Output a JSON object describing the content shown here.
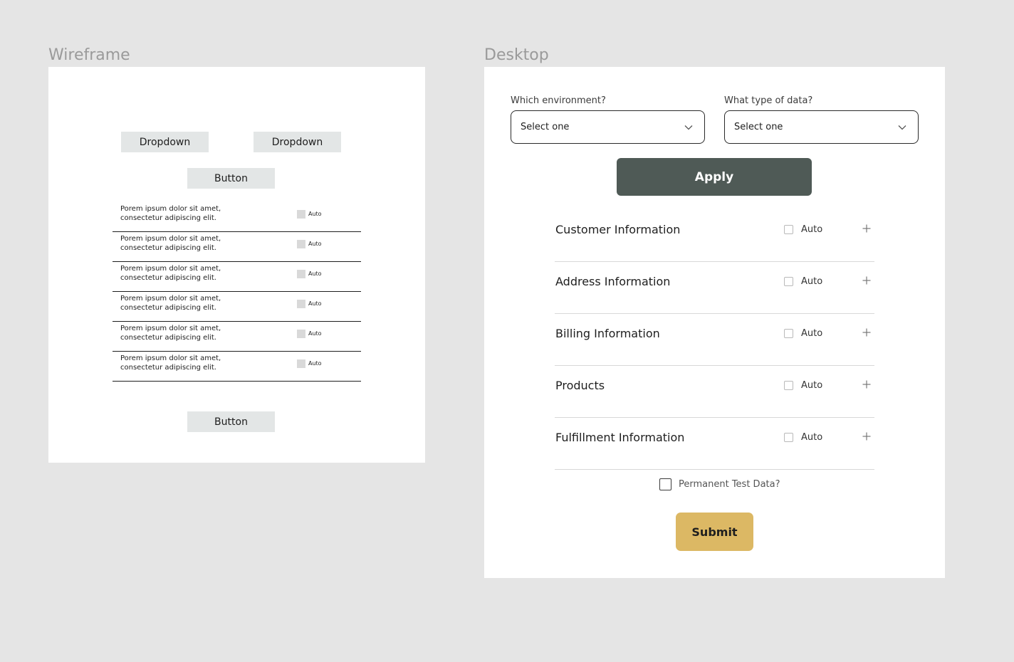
{
  "wireframe": {
    "label": "Wireframe",
    "dropdown_1": "Dropdown",
    "dropdown_2": "Dropdown",
    "button_top": "Button",
    "button_bottom": "Button",
    "rows": [
      {
        "text": "Porem ipsum dolor sit amet,\nconsectetur adipiscing elit.",
        "check_label": "Auto"
      },
      {
        "text": "Porem ipsum dolor sit amet,\nconsectetur adipiscing elit.",
        "check_label": "Auto"
      },
      {
        "text": "Porem ipsum dolor sit amet,\nconsectetur adipiscing elit.",
        "check_label": "Auto"
      },
      {
        "text": "Porem ipsum dolor sit amet,\nconsectetur adipiscing elit.",
        "check_label": "Auto"
      },
      {
        "text": "Porem ipsum dolor sit amet,\nconsectetur adipiscing elit.",
        "check_label": "Auto"
      },
      {
        "text": "Porem ipsum dolor sit amet,\nconsectetur adipiscing elit.",
        "check_label": "Auto"
      }
    ]
  },
  "desktop": {
    "label": "Desktop",
    "environment": {
      "label": "Which environment?",
      "value": "Select one",
      "icon": "chevron-down-icon"
    },
    "data_type": {
      "label": "What type of data?",
      "value": "Select one",
      "icon": "chevron-down-icon"
    },
    "apply_label": "Apply",
    "sections": [
      {
        "title": "Customer Information",
        "check_label": "Auto",
        "checked": false,
        "icon": "plus-icon"
      },
      {
        "title": "Address Information",
        "check_label": "Auto",
        "checked": false,
        "icon": "plus-icon"
      },
      {
        "title": "Billing Information",
        "check_label": "Auto",
        "checked": false,
        "icon": "plus-icon"
      },
      {
        "title": "Products",
        "check_label": "Auto",
        "checked": false,
        "icon": "plus-icon"
      },
      {
        "title": "Fulfillment Information",
        "check_label": "Auto",
        "checked": false,
        "icon": "plus-icon"
      }
    ],
    "permanent_label": "Permanent Test Data?",
    "permanent_checked": false,
    "submit_label": "Submit"
  },
  "colors": {
    "background": "#e5e5e5",
    "wireframe_box": "#e3e6e6",
    "apply_button": "#4f5a56",
    "submit_button": "#dcb864"
  }
}
